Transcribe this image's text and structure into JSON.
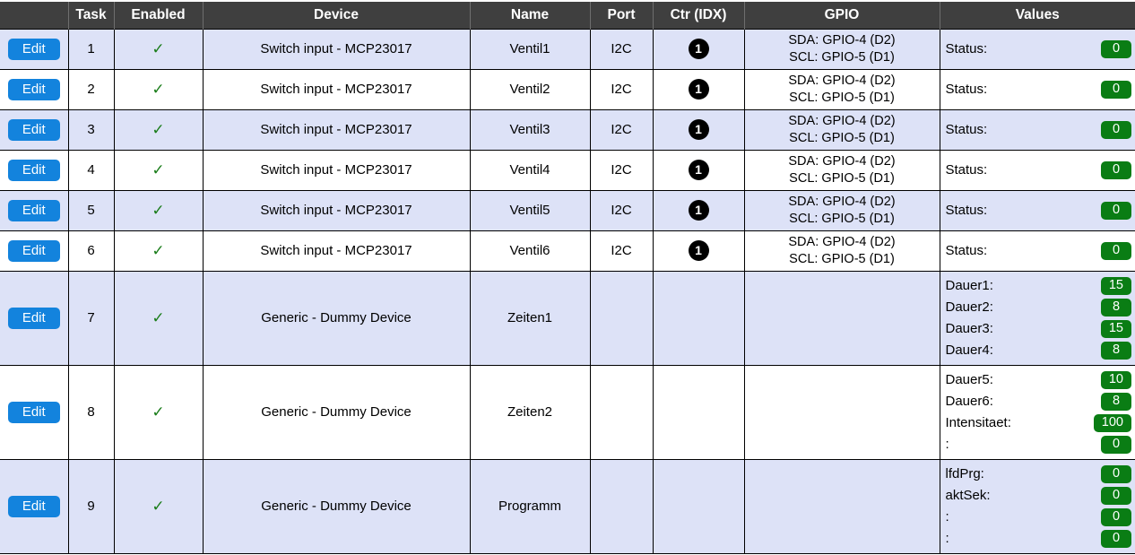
{
  "table": {
    "headers": [
      {
        "key": "edit",
        "label": ""
      },
      {
        "key": "task",
        "label": "Task"
      },
      {
        "key": "enabled",
        "label": "Enabled"
      },
      {
        "key": "device",
        "label": "Device"
      },
      {
        "key": "name",
        "label": "Name"
      },
      {
        "key": "port",
        "label": "Port"
      },
      {
        "key": "ctr",
        "label": "Ctr (IDX)"
      },
      {
        "key": "gpio",
        "label": "GPIO"
      },
      {
        "key": "values",
        "label": "Values"
      }
    ],
    "edit_label": "Edit",
    "enabled_check": "✓",
    "rows": [
      {
        "task": "1",
        "enabled": true,
        "device": "Switch input - MCP23017",
        "name": "Ventil1",
        "port": "I2C",
        "ctr": "1",
        "gpio": [
          "SDA: GPIO-4 (D2)",
          "SCL: GPIO-5 (D1)"
        ],
        "values": [
          {
            "label": "Status:",
            "value": "0"
          }
        ]
      },
      {
        "task": "2",
        "enabled": true,
        "device": "Switch input - MCP23017",
        "name": "Ventil2",
        "port": "I2C",
        "ctr": "1",
        "gpio": [
          "SDA: GPIO-4 (D2)",
          "SCL: GPIO-5 (D1)"
        ],
        "values": [
          {
            "label": "Status:",
            "value": "0"
          }
        ]
      },
      {
        "task": "3",
        "enabled": true,
        "device": "Switch input - MCP23017",
        "name": "Ventil3",
        "port": "I2C",
        "ctr": "1",
        "gpio": [
          "SDA: GPIO-4 (D2)",
          "SCL: GPIO-5 (D1)"
        ],
        "values": [
          {
            "label": "Status:",
            "value": "0"
          }
        ]
      },
      {
        "task": "4",
        "enabled": true,
        "device": "Switch input - MCP23017",
        "name": "Ventil4",
        "port": "I2C",
        "ctr": "1",
        "gpio": [
          "SDA: GPIO-4 (D2)",
          "SCL: GPIO-5 (D1)"
        ],
        "values": [
          {
            "label": "Status:",
            "value": "0"
          }
        ]
      },
      {
        "task": "5",
        "enabled": true,
        "device": "Switch input - MCP23017",
        "name": "Ventil5",
        "port": "I2C",
        "ctr": "1",
        "gpio": [
          "SDA: GPIO-4 (D2)",
          "SCL: GPIO-5 (D1)"
        ],
        "values": [
          {
            "label": "Status:",
            "value": "0"
          }
        ]
      },
      {
        "task": "6",
        "enabled": true,
        "device": "Switch input - MCP23017",
        "name": "Ventil6",
        "port": "I2C",
        "ctr": "1",
        "gpio": [
          "SDA: GPIO-4 (D2)",
          "SCL: GPIO-5 (D1)"
        ],
        "values": [
          {
            "label": "Status:",
            "value": "0"
          }
        ]
      },
      {
        "task": "7",
        "enabled": true,
        "device": "Generic - Dummy Device",
        "name": "Zeiten1",
        "port": "",
        "ctr": "",
        "gpio": [],
        "values": [
          {
            "label": "Dauer1:",
            "value": "15"
          },
          {
            "label": "Dauer2:",
            "value": "8"
          },
          {
            "label": "Dauer3:",
            "value": "15"
          },
          {
            "label": "Dauer4:",
            "value": "8"
          }
        ]
      },
      {
        "task": "8",
        "enabled": true,
        "device": "Generic - Dummy Device",
        "name": "Zeiten2",
        "port": "",
        "ctr": "",
        "gpio": [],
        "values": [
          {
            "label": "Dauer5:",
            "value": "10"
          },
          {
            "label": "Dauer6:",
            "value": "8"
          },
          {
            "label": "Intensitaet:",
            "value": "100"
          },
          {
            "label": ":",
            "value": "0"
          }
        ]
      },
      {
        "task": "9",
        "enabled": true,
        "device": "Generic - Dummy Device",
        "name": "Programm",
        "port": "",
        "ctr": "",
        "gpio": [],
        "values": [
          {
            "label": "lfdPrg:",
            "value": "0"
          },
          {
            "label": "aktSek:",
            "value": "0"
          },
          {
            "label": ":",
            "value": "0"
          },
          {
            "label": ":",
            "value": "0"
          }
        ]
      }
    ]
  },
  "colors": {
    "header_bg": "#3f3f3f",
    "row_shade": "#dde2f7",
    "edit_button": "#1383dd",
    "badge_green": "#0a7d14",
    "check_green": "#1a7d1a"
  }
}
